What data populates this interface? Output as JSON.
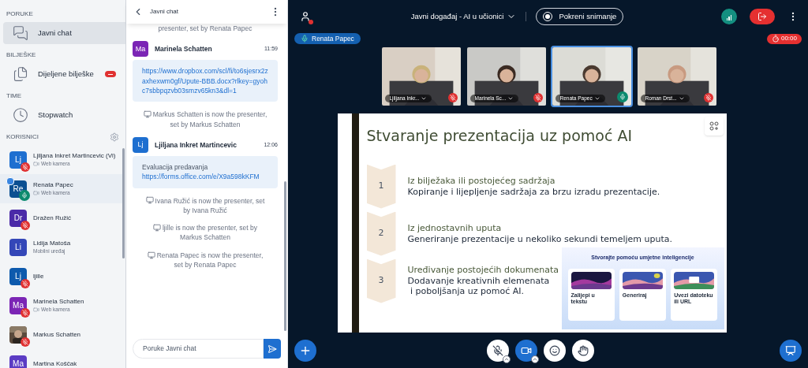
{
  "sidebar": {
    "sections": [
      {
        "title": "PORUKE",
        "items": [
          {
            "kind": "chat",
            "label": "Javni chat",
            "selected": true,
            "unread": false
          }
        ]
      },
      {
        "title": "BILJEŠKE",
        "items": [
          {
            "kind": "notes",
            "label": "Dijeljene bilješke",
            "selected": false,
            "unread": true
          }
        ]
      },
      {
        "title": "TIME",
        "items": [
          {
            "kind": "clock",
            "label": "Stopwatch",
            "selected": false,
            "unread": false
          }
        ]
      }
    ],
    "users_title": "KORISNICI",
    "users": [
      {
        "kind": "initials",
        "initials": "Lj",
        "name": "Ljiljana Inkret Martincevic (Vi)",
        "device": "Web kamera",
        "camera_icon": true,
        "color": "#1e6fd0",
        "muted": true,
        "talking": false,
        "presenter": false
      },
      {
        "kind": "initials",
        "initials": "Re",
        "name": "Renata Papec",
        "device": "Web kamera",
        "camera_icon": true,
        "color": "#0b4f91",
        "muted": false,
        "talking": true,
        "presenter": true
      },
      {
        "kind": "initials",
        "initials": "Dr",
        "name": "Dražen Ružić",
        "color": "#4a2aa8",
        "muted": true,
        "talking": false,
        "presenter": false
      },
      {
        "kind": "initials",
        "initials": "Li",
        "name": "Lidija Matoša",
        "device": "Mobilni uređaj",
        "camera_icon": false,
        "color": "#3447b8",
        "muted": false,
        "talking": false,
        "presenter": false
      },
      {
        "kind": "initials",
        "initials": "Lj",
        "name": "ljille",
        "color": "#0d5aad",
        "muted": true,
        "talking": false,
        "presenter": false
      },
      {
        "kind": "initials",
        "initials": "Ma",
        "name": "Marinela Schatten",
        "device": "Web kamera",
        "camera_icon": true,
        "color": "#7b25b5",
        "muted": true,
        "talking": false,
        "presenter": false
      },
      {
        "kind": "picture",
        "name": "Markus Schatten",
        "muted": true,
        "talking": false,
        "presenter": false
      },
      {
        "kind": "initials",
        "initials": "Ma",
        "name": "Martina Koščak",
        "color": "#5b3cc4",
        "muted": false,
        "talking": false,
        "presenter": false
      }
    ]
  },
  "chat": {
    "title": "Javni chat",
    "messages": [
      {
        "kind": "system",
        "text": "presenter, set by Renata Papec",
        "icon": false
      },
      {
        "kind": "message",
        "initials": "Ma",
        "color": "#7b25b5",
        "author": "Marinela Schatten",
        "time": "11:59",
        "parts": [
          {
            "kind": "link",
            "text": "https://www.dropbox.com/scl/fi/to6sjesrx2zaxhexwm0gf/Upute-BBB.docx?rlkey=gyohc7sbbpqzvb03smzv65kn3&dl=1"
          }
        ]
      },
      {
        "kind": "system",
        "text": "Markus Schatten is now the presenter, set by Markus Schatten",
        "icon": true
      },
      {
        "kind": "message",
        "initials": "Lj",
        "color": "#1e6fd0",
        "author": "Ljiljana Inkret Martincevic",
        "time": "12:06",
        "parts": [
          {
            "kind": "text",
            "text": "Evaluacija predavanja"
          },
          {
            "kind": "link",
            "text": "https://forms.office.com/e/X9a598kKFM"
          }
        ]
      },
      {
        "kind": "system",
        "text": "Ivana Ružić is now the presenter, set by Ivana Ružić",
        "icon": true
      },
      {
        "kind": "system",
        "text": "ljille is now the presenter, set by Markus Schatten",
        "icon": true
      },
      {
        "kind": "system",
        "text": "Renata Papec is now the presenter, set by Renata Papec",
        "icon": true
      }
    ],
    "input": {
      "placeholder": "Poruke Javni chat"
    }
  },
  "meeting": {
    "users_toggle": {
      "notification": true
    },
    "title": "Javni događaj - AI u učionici",
    "record_button": "Pokreni snimanje",
    "presenter": "Renata Papec",
    "timer": "00:00",
    "videos": [
      {
        "name": "Ljiljana Inkr...",
        "muted": true,
        "talking": false
      },
      {
        "name": "Marinela Sc...",
        "muted": true,
        "talking": false
      },
      {
        "name": "Renata Papec",
        "muted": false,
        "talking": true
      },
      {
        "name": "Roman Drst...",
        "muted": true,
        "talking": false
      }
    ],
    "slide": {
      "title": "Stvaranje prezentacija uz pomoć  AI",
      "steps": [
        {
          "number": "1",
          "heading": "Iz bilježaka ili postojećeg sadržaja",
          "body": "Kopiranje i lijepljenje sadržaja za brzu izradu prezentacije."
        },
        {
          "number": "2",
          "heading": "Iz jednostavnih uputa",
          "body": "Generiranje prezentacije u nekoliko sekundi temeljem uputa."
        },
        {
          "number": "3",
          "heading": "Uređivanje postojećih dokumenata",
          "body": "Dodavanje kreativnih elemenata\n i poboljšanja uz pomoć AI."
        }
      ],
      "inset": {
        "title": "Stvorajte pomoću umjetne inteligencije",
        "cards": [
          {
            "label": "Zalijepi u tekstu"
          },
          {
            "label": "Generiraj"
          },
          {
            "label": "Uvezi datoteku ili URL"
          }
        ]
      }
    },
    "controls": {
      "mic_muted": true,
      "camera_on": true
    }
  }
}
